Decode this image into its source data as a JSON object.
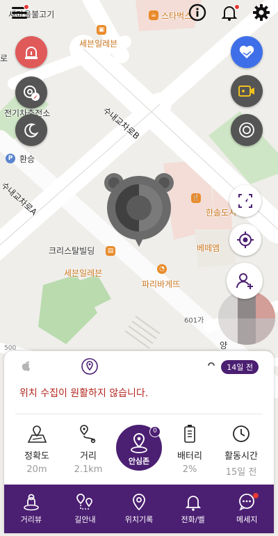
{
  "map": {
    "labels": {
      "restaurant": "새마을불고기",
      "starbucks": "스타벅스",
      "seven_top": "세븐일레븐",
      "ev_station": "전기차충전소",
      "transfer": "환승",
      "road_b": "수내교차로B",
      "road_a": "수내교차로A",
      "crystal": "크리스탈빌딩",
      "seven_bottom": "세븐일레븐",
      "paris": "파리바게뜨",
      "hansol": "한솔도시",
      "bebem": "베떼엠",
      "bldg601": "601가",
      "left_ro": "로",
      "bottom_500": "500",
      "bottom_yang": "양"
    }
  },
  "panel": {
    "days_ago": "14일 전",
    "warning": "위치 수집이 원활하지 않습니다.",
    "stats": {
      "accuracy": {
        "label": "정확도",
        "value": "20m"
      },
      "distance": {
        "label": "거리",
        "value": "2.1km"
      },
      "battery": {
        "label": "배터리",
        "value": "2%"
      },
      "activity": {
        "label": "활동시간",
        "value": "15일 전"
      }
    },
    "safezone": {
      "label": "안심존",
      "badge": "0"
    }
  },
  "tabs": [
    {
      "label": "거리뷰",
      "icon": "street-view-icon"
    },
    {
      "label": "길안내",
      "icon": "route-icon"
    },
    {
      "label": "위치기록",
      "icon": "location-history-icon"
    },
    {
      "label": "전화/벨",
      "icon": "bell-icon"
    },
    {
      "label": "메세지",
      "icon": "message-icon"
    }
  ],
  "colors": {
    "brand_purple": "#4b1f72",
    "alert_red": "#e05a5a",
    "accent_blue": "#3f6fe8",
    "warning_text": "#b3261e"
  }
}
